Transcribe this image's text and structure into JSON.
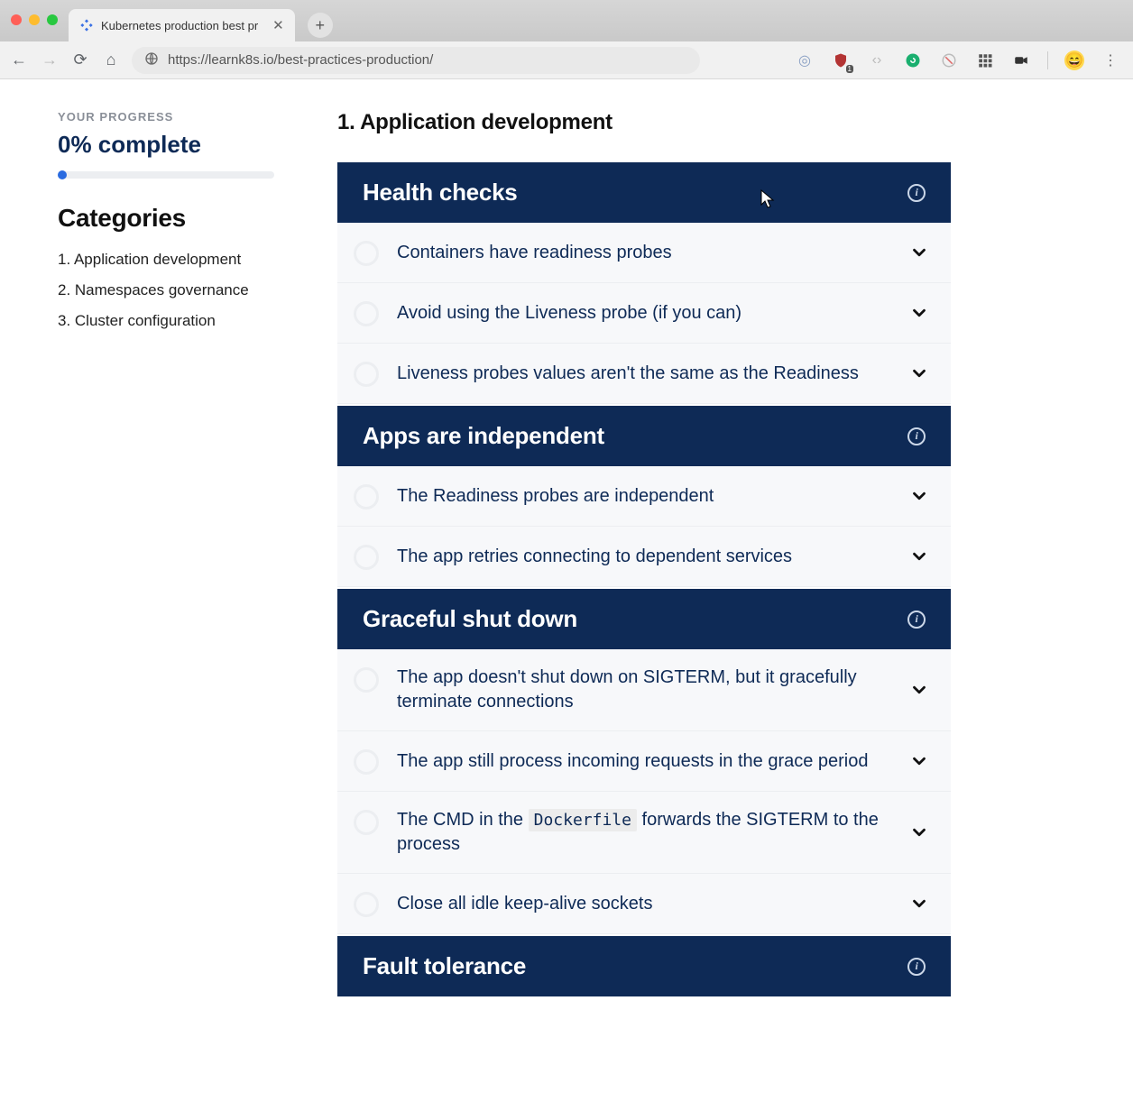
{
  "browser": {
    "tab_title": "Kubernetes production best pr",
    "url": "https://learnk8s.io/best-practices-production/",
    "shield_badge": "1"
  },
  "sidebar": {
    "progress_label": "YOUR PROGRESS",
    "progress_value": "0% complete",
    "categories_title": "Categories",
    "categories": [
      "1. Application development",
      "2. Namespaces governance",
      "3. Cluster configuration"
    ]
  },
  "main": {
    "title": "1. Application development",
    "sections": [
      {
        "title": "Health checks",
        "items": [
          {
            "label": "Containers have readiness probes"
          },
          {
            "label": "Avoid using the Liveness probe (if you can)"
          },
          {
            "label": "Liveness probes values aren't the same as the Readiness"
          }
        ]
      },
      {
        "title": "Apps are independent",
        "items": [
          {
            "label": "The Readiness probes are independent"
          },
          {
            "label": "The app retries connecting to dependent services"
          }
        ]
      },
      {
        "title": "Graceful shut down",
        "items": [
          {
            "label": "The app doesn't shut down on SIGTERM, but it gracefully terminate connections"
          },
          {
            "label": "The app still process incoming requests in the grace period"
          },
          {
            "label_pre": "The CMD in the ",
            "code": "Dockerfile",
            "label_post": " forwards the SIGTERM to the process"
          },
          {
            "label": "Close all idle keep-alive sockets"
          }
        ]
      },
      {
        "title": "Fault tolerance",
        "items": []
      }
    ]
  }
}
